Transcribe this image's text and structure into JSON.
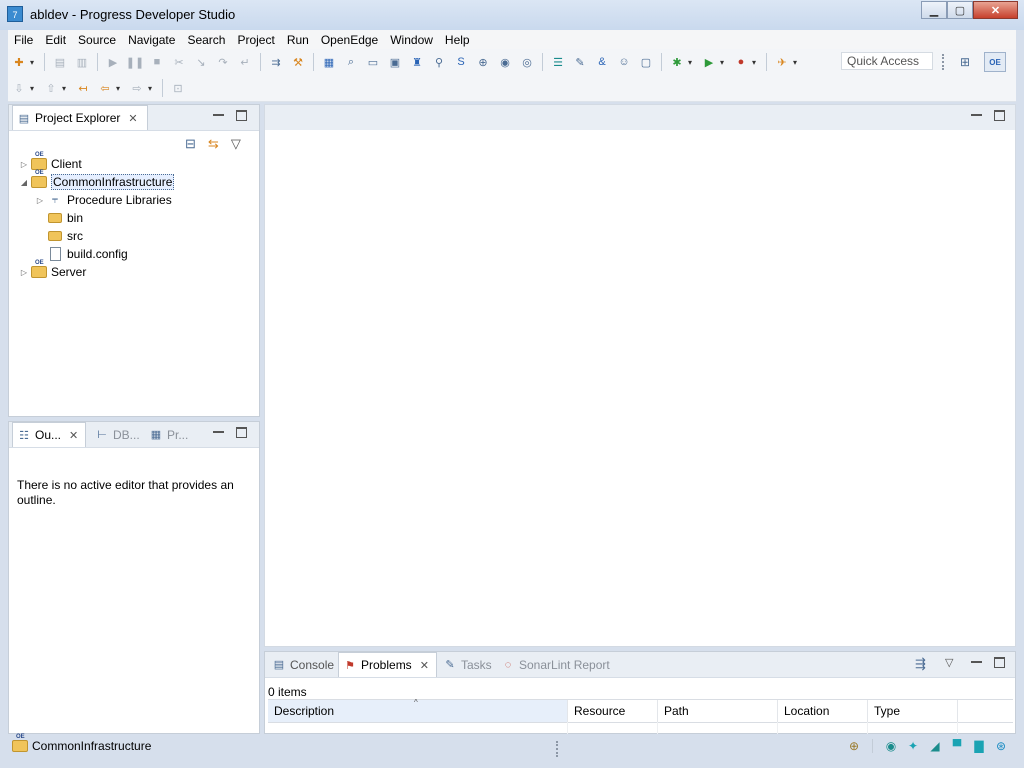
{
  "window": {
    "title": "abldev - Progress Developer Studio",
    "icon": "app-icon"
  },
  "window_buttons": {
    "minimize": "▁",
    "maximize": "▢",
    "close": "✕"
  },
  "menu": [
    "File",
    "Edit",
    "Source",
    "Navigate",
    "Search",
    "Project",
    "Run",
    "OpenEdge",
    "Window",
    "Help"
  ],
  "toolbar": {
    "quick_access": "Quick Access",
    "dropdown_glyph": "▾",
    "icons1": [
      {
        "name": "new-icon",
        "glyph": "✚",
        "cls": "orange",
        "dd": true
      },
      {
        "sep": true
      },
      {
        "name": "save-icon",
        "glyph": "▤",
        "cls": "gray"
      },
      {
        "name": "save-all-icon",
        "glyph": "▥",
        "cls": "gray"
      },
      {
        "sep": true
      },
      {
        "name": "resume-icon",
        "glyph": "▶",
        "cls": "gray"
      },
      {
        "name": "suspend-icon",
        "glyph": "❚❚",
        "cls": "gray"
      },
      {
        "name": "terminate-icon",
        "glyph": "■",
        "cls": "gray"
      },
      {
        "name": "disconnect-icon",
        "glyph": "✂",
        "cls": "gray"
      },
      {
        "name": "step-into-icon",
        "glyph": "↘",
        "cls": "gray"
      },
      {
        "name": "step-over-icon",
        "glyph": "↷",
        "cls": "gray"
      },
      {
        "name": "step-return-icon",
        "glyph": "↵",
        "cls": "gray"
      },
      {
        "sep": true
      },
      {
        "name": "toggle-icon",
        "glyph": "⇉",
        "cls": ""
      },
      {
        "name": "build-icon",
        "glyph": "⚒",
        "cls": "orange"
      },
      {
        "sep": true
      },
      {
        "name": "grid-icon",
        "glyph": "▦",
        "cls": "blue"
      },
      {
        "name": "search-icon",
        "glyph": "⌕",
        "cls": ""
      },
      {
        "name": "terminal-icon",
        "glyph": "▭",
        "cls": ""
      },
      {
        "name": "layout-icon",
        "glyph": "▣",
        "cls": ""
      },
      {
        "name": "ablr-icon",
        "glyph": "♜",
        "cls": "blue"
      },
      {
        "name": "query-icon",
        "glyph": "⚲",
        "cls": ""
      },
      {
        "name": "sql-icon",
        "glyph": "S",
        "cls": "blue"
      },
      {
        "name": "zoom-icon",
        "glyph": "⊕",
        "cls": ""
      },
      {
        "name": "db-icon",
        "glyph": "◉",
        "cls": ""
      },
      {
        "name": "db2-icon",
        "glyph": "◎",
        "cls": ""
      },
      {
        "sep": true
      },
      {
        "name": "database-icon",
        "glyph": "☰",
        "cls": "teal"
      },
      {
        "name": "brush-icon",
        "glyph": "✎",
        "cls": ""
      },
      {
        "name": "ampersand-icon",
        "glyph": "&",
        "cls": "blue"
      },
      {
        "name": "users-icon",
        "glyph": "☺",
        "cls": ""
      },
      {
        "name": "monitor-icon",
        "glyph": "▢",
        "cls": ""
      },
      {
        "sep": true
      },
      {
        "name": "debug-icon",
        "glyph": "✱",
        "cls": "green",
        "dd": true
      },
      {
        "name": "run-icon",
        "glyph": "▶",
        "cls": "green",
        "dd": true
      },
      {
        "name": "run-ext-icon",
        "glyph": "●",
        "cls": "red",
        "dd": true
      },
      {
        "sep": true
      },
      {
        "name": "tools-icon",
        "glyph": "✈",
        "cls": "orange",
        "dd": true
      }
    ],
    "icons2": [
      {
        "name": "next-annotation-icon",
        "glyph": "⇩",
        "cls": "gray",
        "dd": true
      },
      {
        "name": "prev-annotation-icon",
        "glyph": "⇧",
        "cls": "gray",
        "dd": true
      },
      {
        "name": "last-edit-icon",
        "glyph": "↤",
        "cls": "orange"
      },
      {
        "name": "back-icon",
        "glyph": "⇦",
        "cls": "orange",
        "dd": true
      },
      {
        "name": "forward-icon",
        "glyph": "⇨",
        "cls": "gray",
        "dd": true
      },
      {
        "sep": true
      },
      {
        "name": "pin-editor-icon",
        "glyph": "⊡",
        "cls": "gray"
      }
    ]
  },
  "perspective": {
    "open_icon": "open-perspective-icon",
    "oe_label": "OE"
  },
  "project_explorer": {
    "tab_label": "Project Explorer",
    "collapse_icon": "⊟",
    "link_icon": "⇆",
    "view_menu_icon": "▽",
    "tree": [
      {
        "label": "Client",
        "kind": "project",
        "twisty": "▷",
        "depth": 0
      },
      {
        "label": "CommonInfrastructure",
        "kind": "project",
        "twisty": "◢",
        "depth": 0,
        "selected": true
      },
      {
        "label": "Procedure Libraries",
        "kind": "library",
        "twisty": "▷",
        "depth": 1
      },
      {
        "label": "bin",
        "kind": "folder",
        "twisty": "",
        "depth": 1
      },
      {
        "label": "src",
        "kind": "folder",
        "twisty": "",
        "depth": 1
      },
      {
        "label": "build.config",
        "kind": "file",
        "twisty": "",
        "depth": 1
      },
      {
        "label": "Server",
        "kind": "project",
        "twisty": "▷",
        "depth": 0
      }
    ]
  },
  "outline_panel": {
    "tabs": [
      {
        "label": "Ou...",
        "icon": "outline-icon",
        "active": true
      },
      {
        "label": "DB...",
        "icon": "db-structure-icon",
        "active": false
      },
      {
        "label": "Pr...",
        "icon": "properties-icon",
        "active": false
      }
    ],
    "message": "There is no active editor that provides an outline."
  },
  "bottom_panel": {
    "tabs": [
      {
        "label": "Console",
        "icon": "console-icon",
        "active": false
      },
      {
        "label": "Problems",
        "icon": "problems-icon",
        "active": true
      },
      {
        "label": "Tasks",
        "icon": "tasks-icon",
        "active": false
      },
      {
        "label": "SonarLint Report",
        "icon": "sonarlint-icon",
        "active": false
      }
    ],
    "items_count": "0 items",
    "columns": [
      "Description",
      "Resource",
      "Path",
      "Location",
      "Type"
    ],
    "sort_glyph": "^"
  },
  "status": {
    "selected": "CommonInfrastructure",
    "icons": [
      "lock-icon",
      "eye-icon",
      "star-icon",
      "ruler-icon",
      "chat-icon",
      "folder-icon",
      "globe-icon"
    ]
  }
}
